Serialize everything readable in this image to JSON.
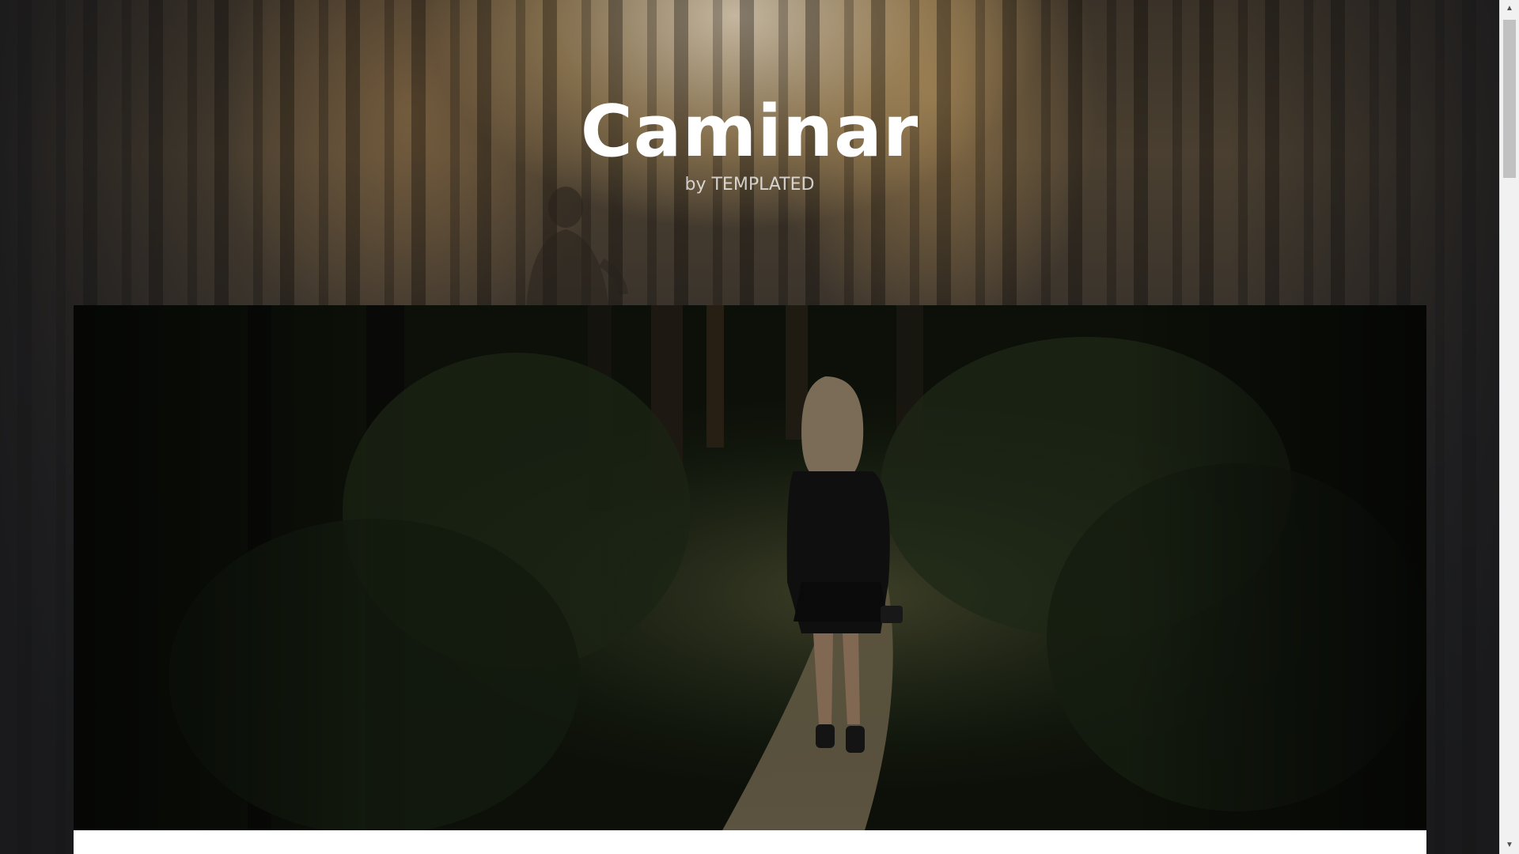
{
  "site": {
    "title": "Caminar",
    "byline": "by TEMPLATED"
  },
  "scrollbar": {
    "up_icon": "triangle-up",
    "down_icon": "triangle-down",
    "up_glyph": "▲",
    "down_glyph": "▼"
  },
  "colors": {
    "page_background": "#1b1b1d",
    "title": "#ffffff",
    "content_panel": "#ffffff"
  }
}
